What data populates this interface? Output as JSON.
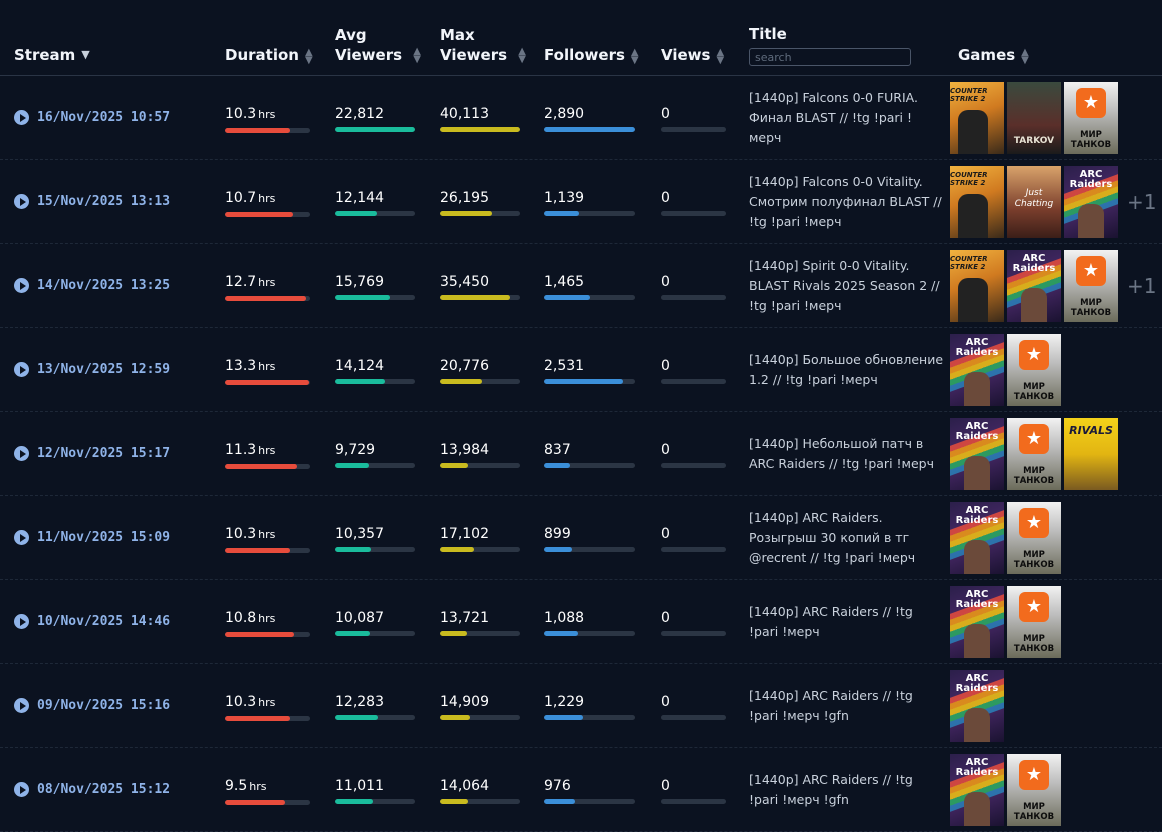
{
  "header": {
    "stream": "Stream",
    "duration": "Duration",
    "avg1": "Avg",
    "avg2": "Viewers",
    "max1": "Max",
    "max2": "Viewers",
    "followers": "Followers",
    "views": "Views",
    "title": "Title",
    "search_placeholder": "search",
    "games": "Games"
  },
  "colors": {
    "duration": "#e74c3c",
    "avg": "#1abc9c",
    "max": "#c9bb1f",
    "followers": "#3b8fd9"
  },
  "unit": "hrs",
  "rows": [
    {
      "date": "16/Nov/2025 10:57",
      "duration": "10.3",
      "avg": "22,812",
      "max": "40,113",
      "followers": "2,890",
      "views": "0",
      "title": "[1440p] Falcons 0-0 FURIA. Финал BLAST // !tg !pari !мерч",
      "fills": [
        0.77,
        1.0,
        1.0,
        1.0
      ],
      "games": [
        "cs",
        "tarkov",
        "tanks"
      ],
      "more": ""
    },
    {
      "date": "15/Nov/2025 13:13",
      "duration": "10.7",
      "avg": "12,144",
      "max": "26,195",
      "followers": "1,139",
      "views": "0",
      "title": "[1440p] Falcons 0-0 Vitality. Смотрим полуфинал BLAST // !tg !pari !мерч",
      "fills": [
        0.8,
        0.53,
        0.65,
        0.39
      ],
      "games": [
        "cs",
        "chat",
        "arc"
      ],
      "more": "+1"
    },
    {
      "date": "14/Nov/2025 13:25",
      "duration": "12.7",
      "avg": "15,769",
      "max": "35,450",
      "followers": "1,465",
      "views": "0",
      "title": "[1440p] Spirit 0-0 Vitality. BLAST Rivals 2025 Season 2 // !tg !pari !мерч",
      "fills": [
        0.95,
        0.69,
        0.88,
        0.5
      ],
      "games": [
        "cs",
        "arc",
        "tanks"
      ],
      "more": "+1"
    },
    {
      "date": "13/Nov/2025 12:59",
      "duration": "13.3",
      "avg": "14,124",
      "max": "20,776",
      "followers": "2,531",
      "views": "0",
      "title": "[1440p] Большое обновление 1.2 // !tg !pari !мерч",
      "fills": [
        0.99,
        0.62,
        0.52,
        0.87
      ],
      "games": [
        "arc",
        "tanks"
      ],
      "more": ""
    },
    {
      "date": "12/Nov/2025 15:17",
      "duration": "11.3",
      "avg": "9,729",
      "max": "13,984",
      "followers": "837",
      "views": "0",
      "title": "[1440p] Небольшой патч в ARC Raiders // !tg !pari !мерч",
      "fills": [
        0.85,
        0.43,
        0.35,
        0.29
      ],
      "games": [
        "arc",
        "tanks",
        "rivals"
      ],
      "more": ""
    },
    {
      "date": "11/Nov/2025 15:09",
      "duration": "10.3",
      "avg": "10,357",
      "max": "17,102",
      "followers": "899",
      "views": "0",
      "title": "[1440p] ARC Raiders. Розыгрыш 30 копий в тг @recrent // !tg !pari !мерч",
      "fills": [
        0.76,
        0.45,
        0.42,
        0.31
      ],
      "games": [
        "arc",
        "tanks"
      ],
      "more": ""
    },
    {
      "date": "10/Nov/2025 14:46",
      "duration": "10.8",
      "avg": "10,087",
      "max": "13,721",
      "followers": "1,088",
      "views": "0",
      "title": "[1440p] ARC Raiders // !tg !pari !мерч",
      "fills": [
        0.81,
        0.44,
        0.34,
        0.37
      ],
      "games": [
        "arc",
        "tanks"
      ],
      "more": ""
    },
    {
      "date": "09/Nov/2025 15:16",
      "duration": "10.3",
      "avg": "12,283",
      "max": "14,909",
      "followers": "1,229",
      "views": "0",
      "title": "[1440p] ARC Raiders // !tg !pari !мерч !gfn",
      "fills": [
        0.76,
        0.54,
        0.37,
        0.43
      ],
      "games": [
        "arc"
      ],
      "more": ""
    },
    {
      "date": "08/Nov/2025 15:12",
      "duration": "9.5",
      "avg": "11,011",
      "max": "14,064",
      "followers": "976",
      "views": "0",
      "title": "[1440p] ARC Raiders // !tg !pari !мерч !gfn",
      "fills": [
        0.71,
        0.48,
        0.35,
        0.34
      ],
      "games": [
        "arc",
        "tanks"
      ],
      "more": ""
    }
  ],
  "game_labels": {
    "cs": "COUNTER STRIKE 2",
    "tarkov": "TARKOV",
    "arc": "ARC Raiders",
    "tanks": "МИР ТАНКОВ",
    "chat": "Just Chatting",
    "rivals": "RIVALS"
  }
}
